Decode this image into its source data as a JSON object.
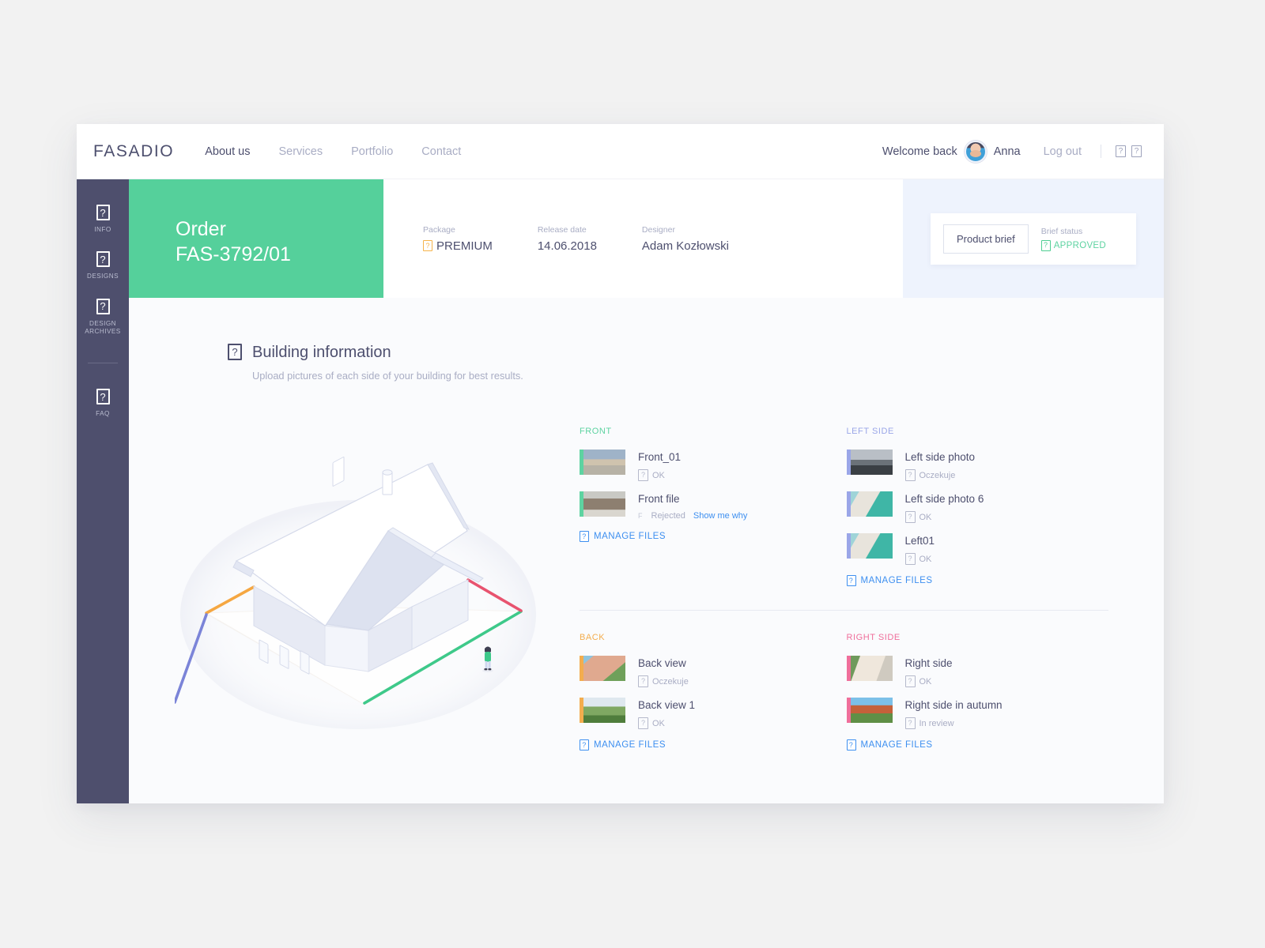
{
  "brand": "FASADIO",
  "nav": {
    "links": [
      {
        "label": "About us",
        "active": true
      },
      {
        "label": "Services",
        "active": false
      },
      {
        "label": "Portfolio",
        "active": false
      },
      {
        "label": "Contact",
        "active": false
      }
    ],
    "welcome": "Welcome back",
    "user": "Anna",
    "logout": "Log out",
    "icons": [
      "help-icon",
      "notification-icon"
    ]
  },
  "sidebar": {
    "items": [
      {
        "label": "INFO",
        "icon": "info-icon"
      },
      {
        "label": "DESIGNS",
        "icon": "designs-icon"
      },
      {
        "label": "DESIGN ARCHIVES",
        "icon": "archive-icon"
      },
      {
        "label": "FAQ",
        "icon": "faq-icon"
      }
    ]
  },
  "order": {
    "heading": "Order",
    "number": "FAS-3792/01",
    "meta": [
      {
        "label": "Package",
        "value": "PREMIUM",
        "icon": "premium-badge-icon"
      },
      {
        "label": "Release date",
        "value": "14.06.2018",
        "icon": ""
      },
      {
        "label": "Designer",
        "value": "Adam Kozłowski",
        "icon": ""
      }
    ],
    "brief_button": "Product brief",
    "brief_status_label": "Brief status",
    "brief_status_value": "APPROVED"
  },
  "section": {
    "title": "Building information",
    "subtitle": "Upload pictures of each side of your building for best results."
  },
  "manage_files_label": "MANAGE FILES",
  "panels": [
    {
      "id": "front",
      "title": "FRONT",
      "color": "#5ed3a1",
      "files": [
        {
          "name": "Front_01",
          "status": "OK",
          "lead": "",
          "link": ""
        },
        {
          "name": "Front file",
          "status": "Rejected",
          "lead": "F",
          "link": "Show me why"
        }
      ]
    },
    {
      "id": "left",
      "title": "LEFT SIDE",
      "color": "#9aa6e8",
      "files": [
        {
          "name": "Left side photo",
          "status": "Oczekuje",
          "lead": "",
          "link": ""
        },
        {
          "name": "Left side photo 6",
          "status": "OK",
          "lead": "",
          "link": ""
        },
        {
          "name": "Left01",
          "status": "OK",
          "lead": "",
          "link": ""
        }
      ]
    },
    {
      "id": "back",
      "title": "BACK",
      "color": "#f3ad4e",
      "files": [
        {
          "name": "Back view",
          "status": "Oczekuje",
          "lead": "",
          "link": ""
        },
        {
          "name": "Back view 1",
          "status": "OK",
          "lead": "",
          "link": ""
        }
      ]
    },
    {
      "id": "right",
      "title": "RIGHT SIDE",
      "color": "#ef6f9b",
      "files": [
        {
          "name": "Right side",
          "status": "OK",
          "lead": "",
          "link": ""
        },
        {
          "name": "Right side in autumn",
          "status": "In review",
          "lead": "",
          "link": ""
        }
      ]
    }
  ],
  "illustration": {
    "name": "isometric-house-illustration",
    "edge_colors": {
      "back": "#f5a742",
      "left": "#7b84d8",
      "front": "#3ec98a",
      "right": "#e8536f"
    }
  },
  "glyph": "?"
}
